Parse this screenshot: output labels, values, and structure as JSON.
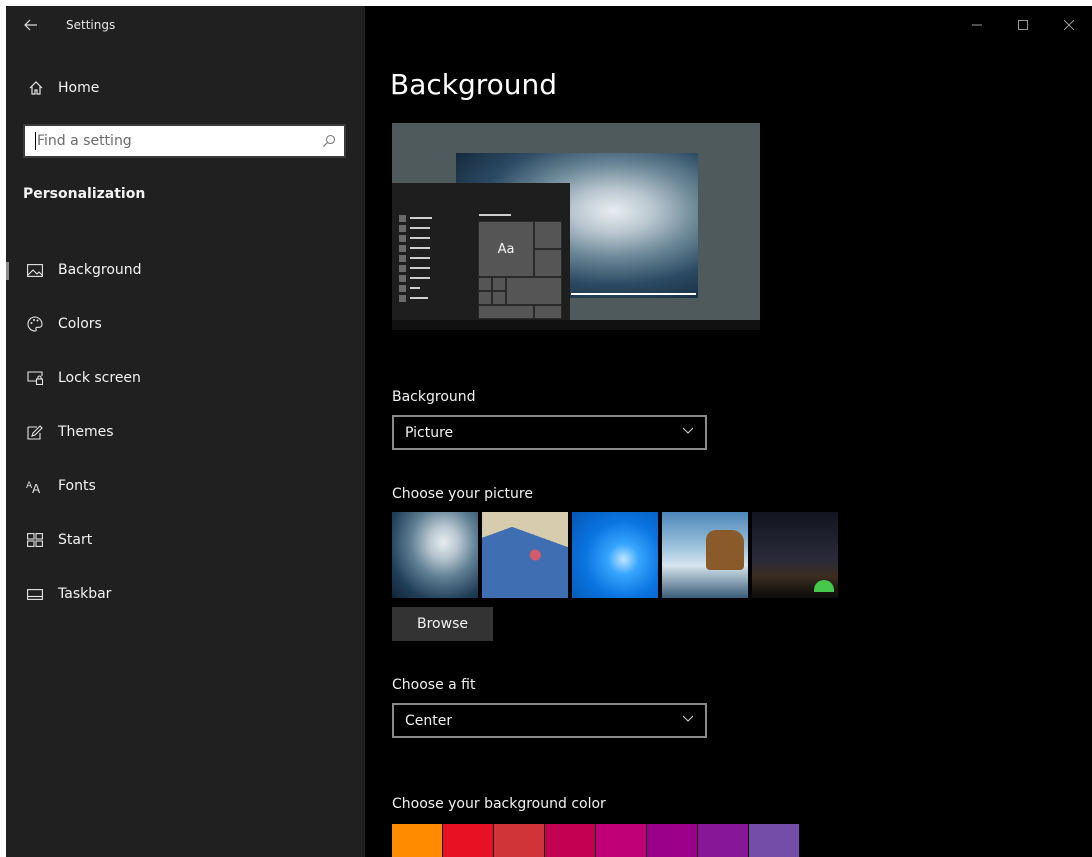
{
  "window": {
    "title": "Settings",
    "controls": {
      "minimize": "minimize-icon",
      "maximize": "maximize-icon",
      "close": "close-icon"
    }
  },
  "sidebar": {
    "back_icon": "back-arrow-icon",
    "home_label": "Home",
    "search_placeholder": "Find a setting",
    "section_header": "Personalization",
    "items": [
      {
        "label": "Background",
        "icon": "picture-icon",
        "active": true
      },
      {
        "label": "Colors",
        "icon": "palette-icon",
        "active": false
      },
      {
        "label": "Lock screen",
        "icon": "lock-screen-icon",
        "active": false
      },
      {
        "label": "Themes",
        "icon": "themes-icon",
        "active": false
      },
      {
        "label": "Fonts",
        "icon": "fonts-icon",
        "active": false
      },
      {
        "label": "Start",
        "icon": "start-icon",
        "active": false
      },
      {
        "label": "Taskbar",
        "icon": "taskbar-icon",
        "active": false
      }
    ]
  },
  "main": {
    "title": "Background",
    "preview_tile_text": "Aa",
    "background_label": "Background",
    "background_value": "Picture",
    "choose_picture_label": "Choose your picture",
    "browse_label": "Browse",
    "fit_label": "Choose a fit",
    "fit_value": "Center",
    "color_label": "Choose your background color",
    "colors": [
      "#FF8C00",
      "#E81123",
      "#D13438",
      "#C30052",
      "#BF0077",
      "#9A0089",
      "#881798",
      "#744DA9"
    ]
  }
}
